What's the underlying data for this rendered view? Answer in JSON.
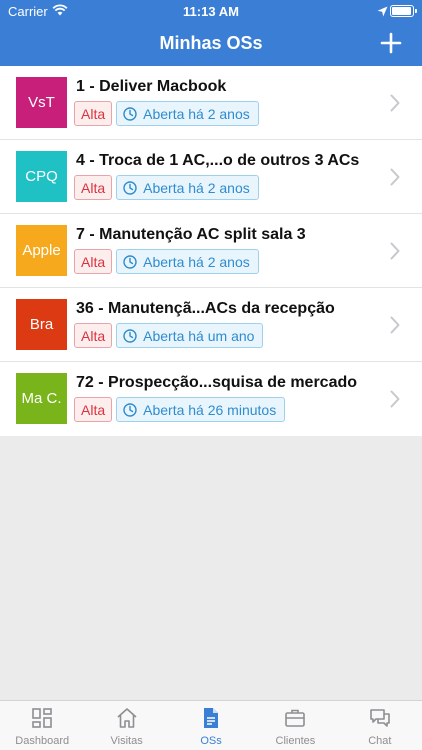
{
  "status_bar": {
    "carrier": "Carrier",
    "time": "11:13 AM"
  },
  "header": {
    "title": "Minhas OSs",
    "add_icon": "plus-icon"
  },
  "colors": {
    "brand": "#3a7fd5",
    "priority": "#d9333f",
    "status_info": "#2f8ccf"
  },
  "orders": [
    {
      "avatar": "VsT",
      "avatar_color": "#c8207a",
      "title": "1 - Deliver Macbook",
      "priority": "Alta",
      "status": "Aberta há 2 anos"
    },
    {
      "avatar": "CPQ",
      "avatar_color": "#20c1c4",
      "title": "4 - Troca de 1 AC,...o de outros 3 ACs",
      "priority": "Alta",
      "status": "Aberta há 2 anos"
    },
    {
      "avatar": "Apple",
      "avatar_color": "#f6a91c",
      "title": "7 - Manutenção AC split sala 3",
      "priority": "Alta",
      "status": "Aberta há 2 anos"
    },
    {
      "avatar": "Bra",
      "avatar_color": "#dc3a12",
      "title": "36 - Manutençã...ACs da recepção",
      "priority": "Alta",
      "status": "Aberta há um ano"
    },
    {
      "avatar": "Ma C.",
      "avatar_color": "#79b51a",
      "title": "72 - Prospecção...squisa de mercado",
      "priority": "Alta",
      "status": "Aberta há 26 minutos"
    }
  ],
  "tabbar": {
    "active": "OSs",
    "tabs": [
      {
        "label": "Dashboard",
        "icon": "dashboard-icon"
      },
      {
        "label": "Visitas",
        "icon": "home-icon"
      },
      {
        "label": "OSs",
        "icon": "document-icon"
      },
      {
        "label": "Clientes",
        "icon": "briefcase-icon"
      },
      {
        "label": "Chat",
        "icon": "chat-icon"
      }
    ]
  }
}
